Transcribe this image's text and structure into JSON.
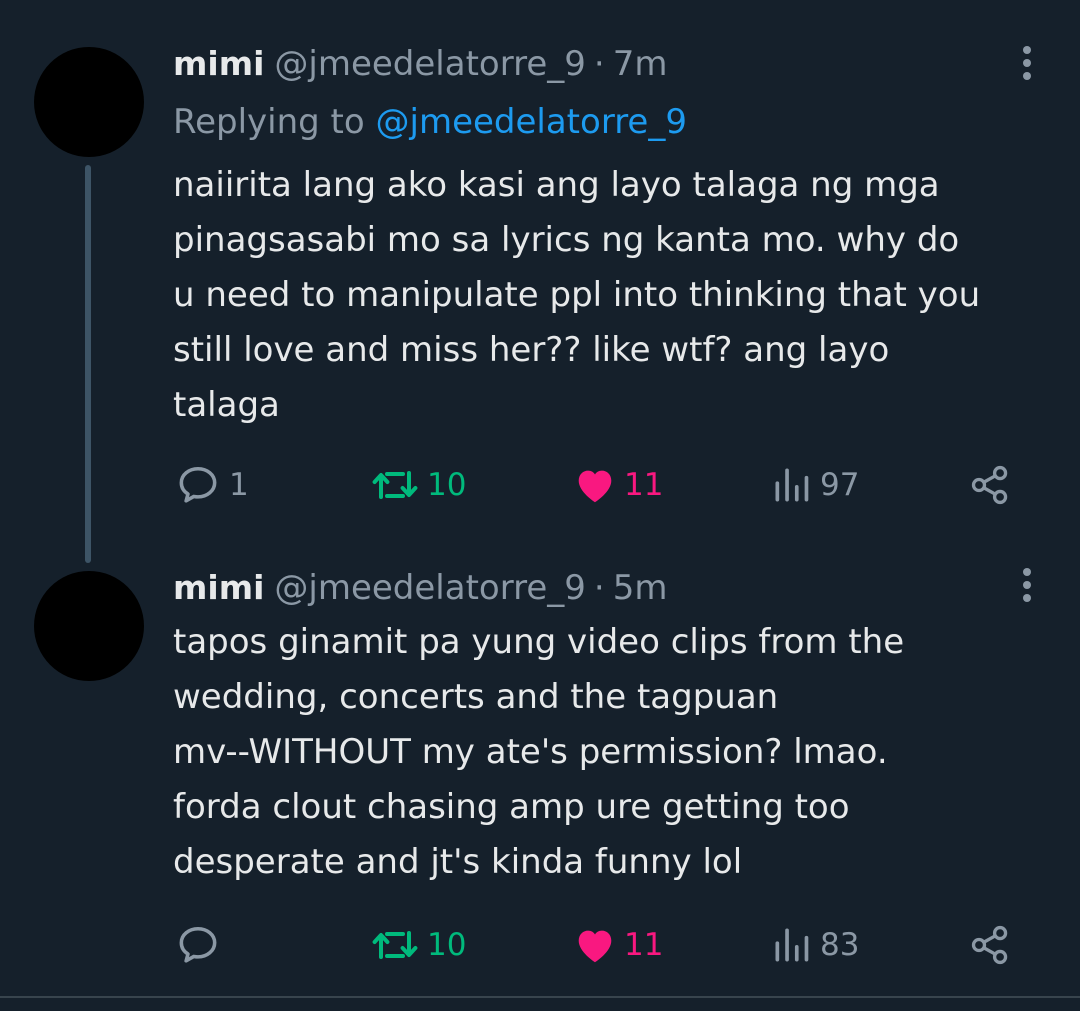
{
  "tweets": [
    {
      "name": "mimi",
      "handle": "@jmeedelatorre_9",
      "separator": "·",
      "time": "7m",
      "replying_prefix": "Replying to",
      "replying_to": "@jmeedelatorre_9",
      "text": "naiirita lang ako kasi ang layo talaga ng mga\npinagsasabi mo sa lyrics ng kanta mo. why do\nu need to manipulate ppl into thinking that you\nstill love and miss her?? like wtf? ang layo\ntalaga",
      "replies": "1",
      "retweets": "10",
      "likes": "11",
      "views": "97"
    },
    {
      "name": "mimi",
      "handle": "@jmeedelatorre_9",
      "separator": "·",
      "time": "5m",
      "text": "tapos ginamit pa yung video clips from the\nwedding, concerts and the tagpuan\nmv--WITHOUT my ate's permission? lmao.\nforda clout chasing amp ure getting too\ndesperate and jt's kinda funny lol",
      "replies": "",
      "retweets": "10",
      "likes": "11",
      "views": "83"
    }
  ],
  "colors": {
    "background": "#15202b",
    "text_primary": "#e7e9ea",
    "text_secondary": "#8b98a5",
    "link": "#1d9bf0",
    "retweet": "#00ba7c",
    "like": "#f91880",
    "thread_line": "#3d5466"
  },
  "icons": [
    "more-vertical-icon",
    "reply-icon",
    "retweet-icon",
    "heart-icon",
    "views-icon",
    "share-icon"
  ]
}
